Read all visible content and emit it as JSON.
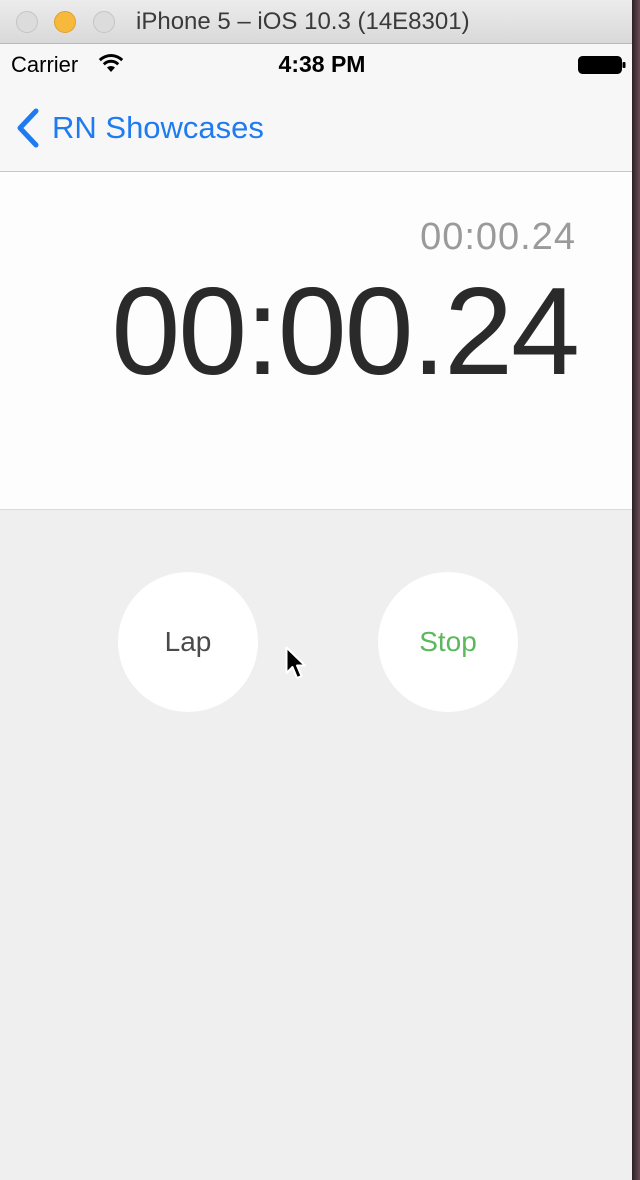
{
  "window": {
    "title": "iPhone 5 – iOS 10.3 (14E8301)"
  },
  "status_bar": {
    "carrier": "Carrier",
    "time": "4:38 PM",
    "icons": [
      "wifi-icon",
      "battery-icon"
    ]
  },
  "nav": {
    "back_label": "RN Showcases",
    "back_icon": "chevron-left-icon",
    "accent_color": "#1e7cf0"
  },
  "stopwatch": {
    "lap_time": "00:00.24",
    "main_time": "00:00.24"
  },
  "controls": {
    "lap_label": "Lap",
    "stop_label": "Stop",
    "stop_color": "#5cb85c"
  }
}
